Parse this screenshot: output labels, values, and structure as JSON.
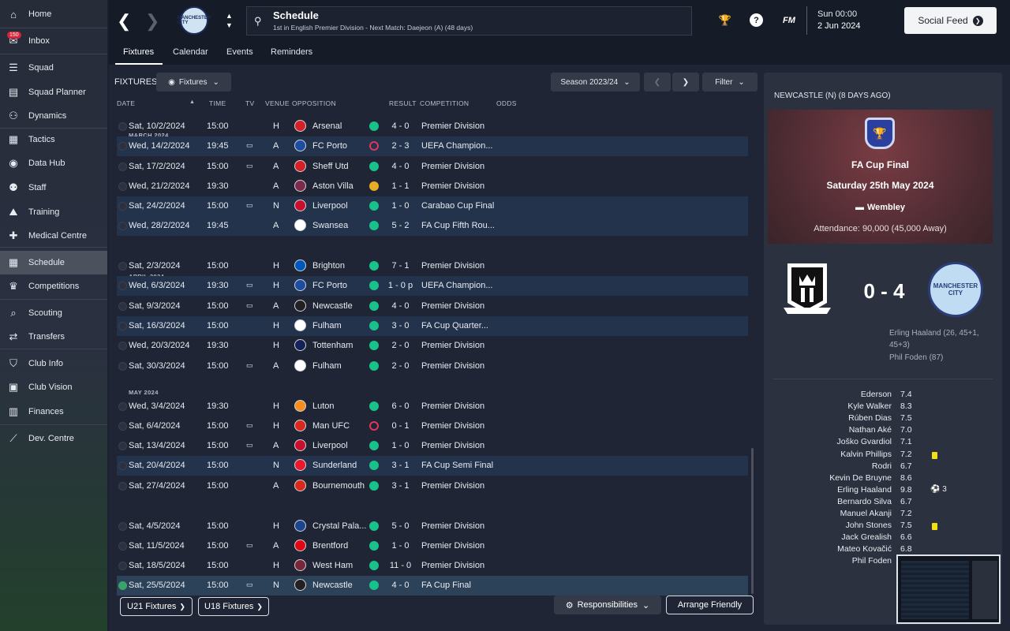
{
  "sidebar": {
    "items": [
      {
        "label": "Home",
        "icon": "home-icon"
      },
      {
        "label": "Inbox",
        "icon": "inbox-icon",
        "badge": "150"
      },
      {
        "label": "Squad",
        "icon": "squad-icon"
      },
      {
        "label": "Squad Planner",
        "icon": "clipboard-icon"
      },
      {
        "label": "Dynamics",
        "icon": "dynamics-icon"
      },
      {
        "label": "Tactics",
        "icon": "tactics-icon"
      },
      {
        "label": "Data Hub",
        "icon": "data-hub-icon"
      },
      {
        "label": "Staff",
        "icon": "staff-icon"
      },
      {
        "label": "Training",
        "icon": "training-icon"
      },
      {
        "label": "Medical Centre",
        "icon": "medical-icon"
      },
      {
        "label": "Schedule",
        "icon": "calendar-icon",
        "active": true
      },
      {
        "label": "Competitions",
        "icon": "trophy-icon"
      },
      {
        "label": "Scouting",
        "icon": "scouting-icon"
      },
      {
        "label": "Transfers",
        "icon": "transfers-icon"
      },
      {
        "label": "Club Info",
        "icon": "shield-icon"
      },
      {
        "label": "Club Vision",
        "icon": "vision-icon"
      },
      {
        "label": "Finances",
        "icon": "finances-icon"
      },
      {
        "label": "Dev. Centre",
        "icon": "dev-centre-icon"
      }
    ]
  },
  "header": {
    "title": "Schedule",
    "subtitle": "1st in English Premier Division - Next Match: Daejeon (A) (48 days)",
    "club_crest_text": "MANCHESTER CITY",
    "time": "Sun 00:00",
    "date": "2 Jun 2024",
    "fm_logo": "FM",
    "social_feed": "Social Feed"
  },
  "tabs": [
    "Fixtures",
    "Calendar",
    "Events",
    "Reminders"
  ],
  "panel": {
    "title": "FIXTURES",
    "view_button": "Fixtures",
    "season": "Season 2023/24",
    "filter": "Filter",
    "columns": [
      "DATE",
      "TIME",
      "TV",
      "VENUE",
      "OPPOSITION",
      "RESULT",
      "COMPETITION",
      "ODDS"
    ]
  },
  "months": [
    "MARCH 2024",
    "APRIL 2024",
    "MAY 2024"
  ],
  "fixtures": [
    {
      "date": "Sat, 10/2/2024",
      "time": "15:00",
      "tv": "",
      "venue": "H",
      "opp": "Arsenal",
      "res": "w",
      "score": "4 - 0",
      "comp": "Premier Division",
      "hl": false,
      "crest": "#d71f26"
    },
    {
      "date": "Wed, 14/2/2024",
      "time": "19:45",
      "tv": "tv",
      "venue": "A",
      "opp": "FC Porto",
      "res": "l",
      "score": "2 - 3",
      "comp": "UEFA Champion...",
      "hl": true,
      "crest": "#1c4da1"
    },
    {
      "date": "Sat, 17/2/2024",
      "time": "15:00",
      "tv": "tv",
      "venue": "A",
      "opp": "Sheff Utd",
      "res": "w",
      "score": "4 - 0",
      "comp": "Premier Division",
      "hl": false,
      "crest": "#d71f26"
    },
    {
      "date": "Wed, 21/2/2024",
      "time": "19:30",
      "tv": "",
      "venue": "A",
      "opp": "Aston Villa",
      "res": "d",
      "score": "1 - 1",
      "comp": "Premier Division",
      "hl": false,
      "crest": "#7b2c4c"
    },
    {
      "date": "Sat, 24/2/2024",
      "time": "15:00",
      "tv": "tv",
      "venue": "N",
      "opp": "Liverpool",
      "res": "w",
      "score": "1 - 0",
      "comp": "Carabao Cup Final",
      "hl": true,
      "crest": "#c8102e"
    },
    {
      "date": "Wed, 28/2/2024",
      "time": "19:45",
      "tv": "",
      "venue": "A",
      "opp": "Swansea",
      "res": "w",
      "score": "5 - 2",
      "comp": "FA Cup Fifth Rou...",
      "hl": true,
      "crest": "#ffffff"
    },
    {
      "date": "Sat, 2/3/2024",
      "time": "15:00",
      "tv": "",
      "venue": "H",
      "opp": "Brighton",
      "res": "w",
      "score": "7 - 1",
      "comp": "Premier Division",
      "hl": false,
      "crest": "#0057b8"
    },
    {
      "date": "Wed, 6/3/2024",
      "time": "19:30",
      "tv": "tv",
      "venue": "H",
      "opp": "FC Porto",
      "res": "w",
      "score": "1 - 0 p",
      "comp": "UEFA Champion...",
      "hl": true,
      "crest": "#1c4da1"
    },
    {
      "date": "Sat, 9/3/2024",
      "time": "15:00",
      "tv": "tv",
      "venue": "A",
      "opp": "Newcastle",
      "res": "w",
      "score": "4 - 0",
      "comp": "Premier Division",
      "hl": false,
      "crest": "#241f20"
    },
    {
      "date": "Sat, 16/3/2024",
      "time": "15:00",
      "tv": "",
      "venue": "H",
      "opp": "Fulham",
      "res": "w",
      "score": "3 - 0",
      "comp": "FA Cup Quarter...",
      "hl": true,
      "crest": "#ffffff"
    },
    {
      "date": "Wed, 20/3/2024",
      "time": "19:30",
      "tv": "",
      "venue": "H",
      "opp": "Tottenham",
      "res": "w",
      "score": "2 - 0",
      "comp": "Premier Division",
      "hl": false,
      "crest": "#132257"
    },
    {
      "date": "Sat, 30/3/2024",
      "time": "15:00",
      "tv": "tv",
      "venue": "A",
      "opp": "Fulham",
      "res": "w",
      "score": "2 - 0",
      "comp": "Premier Division",
      "hl": false,
      "crest": "#ffffff"
    },
    {
      "date": "Wed, 3/4/2024",
      "time": "19:30",
      "tv": "",
      "venue": "H",
      "opp": "Luton",
      "res": "w",
      "score": "6 - 0",
      "comp": "Premier Division",
      "hl": false,
      "crest": "#f78f1e"
    },
    {
      "date": "Sat, 6/4/2024",
      "time": "15:00",
      "tv": "tv",
      "venue": "H",
      "opp": "Man UFC",
      "res": "l",
      "score": "0 - 1",
      "comp": "Premier Division",
      "hl": false,
      "crest": "#da291c"
    },
    {
      "date": "Sat, 13/4/2024",
      "time": "15:00",
      "tv": "tv",
      "venue": "A",
      "opp": "Liverpool",
      "res": "w",
      "score": "1 - 0",
      "comp": "Premier Division",
      "hl": false,
      "crest": "#c8102e"
    },
    {
      "date": "Sat, 20/4/2024",
      "time": "15:00",
      "tv": "",
      "venue": "N",
      "opp": "Sunderland",
      "res": "w",
      "score": "3 - 1",
      "comp": "FA Cup Semi Final",
      "hl": true,
      "crest": "#eb172b"
    },
    {
      "date": "Sat, 27/4/2024",
      "time": "15:00",
      "tv": "",
      "venue": "A",
      "opp": "Bournemouth",
      "res": "w",
      "score": "3 - 1",
      "comp": "Premier Division",
      "hl": false,
      "crest": "#da291c"
    },
    {
      "date": "Sat, 4/5/2024",
      "time": "15:00",
      "tv": "",
      "venue": "H",
      "opp": "Crystal Pala...",
      "res": "w",
      "score": "5 - 0",
      "comp": "Premier Division",
      "hl": false,
      "crest": "#1b458f"
    },
    {
      "date": "Sat, 11/5/2024",
      "time": "15:00",
      "tv": "tv",
      "venue": "A",
      "opp": "Brentford",
      "res": "w",
      "score": "1 - 0",
      "comp": "Premier Division",
      "hl": false,
      "crest": "#e30613"
    },
    {
      "date": "Sat, 18/5/2024",
      "time": "15:00",
      "tv": "",
      "venue": "H",
      "opp": "West Ham",
      "res": "w",
      "score": "11 - 0",
      "comp": "Premier Division",
      "hl": false,
      "crest": "#7a263a"
    },
    {
      "date": "Sat, 25/5/2024",
      "time": "15:00",
      "tv": "tv",
      "venue": "N",
      "opp": "Newcastle",
      "res": "w",
      "score": "4 - 0",
      "comp": "FA Cup Final",
      "hl": false,
      "last": true,
      "crest": "#241f20"
    }
  ],
  "bottom": {
    "u21": "U21 Fixtures",
    "u18": "U18 Fixtures",
    "responsibilities": "Responsibilities",
    "arrange": "Arrange Friendly"
  },
  "match": {
    "header": "NEWCASTLE (N) (8 DAYS AGO)",
    "competition": "FA Cup Final",
    "date": "Saturday 25th May 2024",
    "venue": "Wembley",
    "attendance": "Attendance: 90,000 (45,000 Away)",
    "score": "0 - 4",
    "away_crest_text": "MANCHESTER CITY",
    "scorers": [
      "Erling Haaland (26, 45+1,",
      "45+3)",
      "Phil Foden (87)"
    ],
    "players": [
      {
        "name": "Ederson",
        "rating": "7.4"
      },
      {
        "name": "Kyle Walker",
        "rating": "8.3"
      },
      {
        "name": "Rúben Dias",
        "rating": "7.5"
      },
      {
        "name": "Nathan Aké",
        "rating": "7.0"
      },
      {
        "name": "Joško Gvardiol",
        "rating": "7.1"
      },
      {
        "name": "Kalvin Phillips",
        "rating": "7.2",
        "yellow": true
      },
      {
        "name": "Rodri",
        "rating": "6.7"
      },
      {
        "name": "Kevin De Bruyne",
        "rating": "8.6"
      },
      {
        "name": "Erling Haaland",
        "rating": "9.8",
        "goals": "3"
      },
      {
        "name": "Bernardo Silva",
        "rating": "6.7"
      },
      {
        "name": "Manuel Akanji",
        "rating": "7.2"
      },
      {
        "name": "John Stones",
        "rating": "7.5",
        "yellow": true
      },
      {
        "name": "Jack Grealish",
        "rating": "6.6"
      },
      {
        "name": "Mateo Kovačić",
        "rating": "6.8"
      },
      {
        "name": "Phil Foden",
        "rating": ""
      }
    ]
  }
}
